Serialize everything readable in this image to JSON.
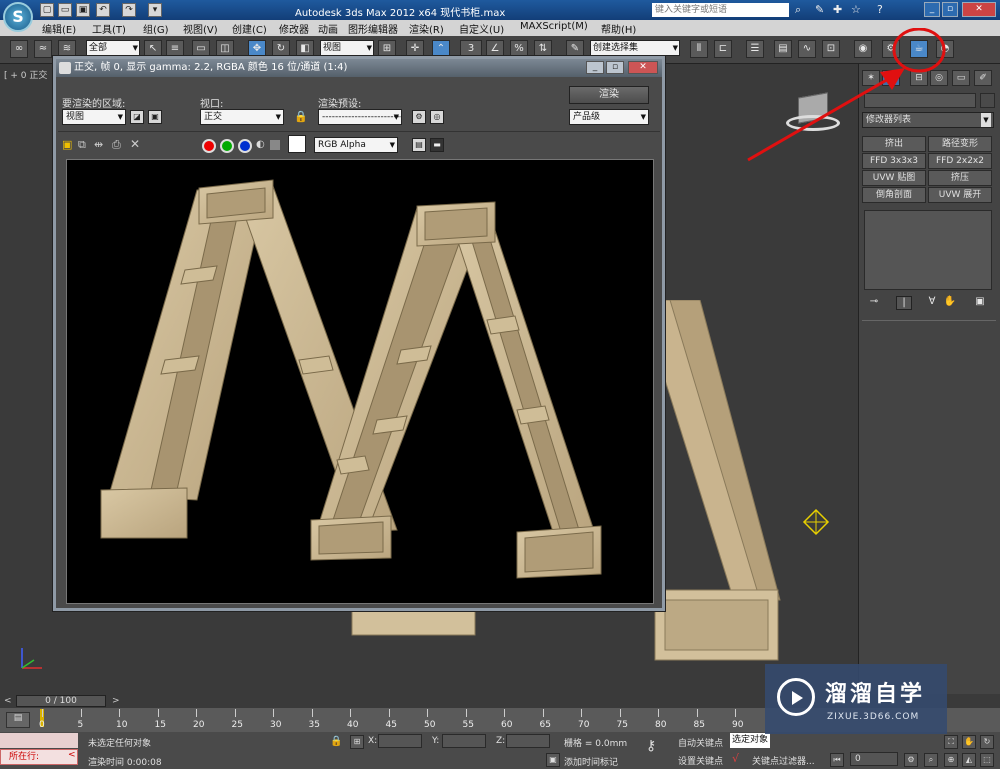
{
  "app": {
    "title": "Autodesk 3ds Max  2012 x64    现代书柜.max",
    "logo": "S",
    "search_placeholder": "键入关键字或短语"
  },
  "menu": [
    "编辑(E)",
    "工具(T)",
    "组(G)",
    "视图(V)",
    "创建(C)",
    "修改器",
    "动画",
    "图形编辑器",
    "渲染(R)",
    "自定义(U)",
    "MAXScript(M)",
    "帮助(H)"
  ],
  "toolbar": {
    "selection_filter": "全部",
    "reference_coord": "视图",
    "named_selection": "创建选择集",
    "snap_value": "3",
    "percent_snap": "%"
  },
  "viewport": {
    "label": "[ + 0 正交"
  },
  "render_window": {
    "title": "正交, 帧 0, 显示 gamma: 2.2, RGBA 颜色 16 位/通道 (1:4)",
    "area_label": "要渲染的区域:",
    "area_value": "视图",
    "viewport_label": "视口:",
    "viewport_value": "正交",
    "preset_label": "渲染预设:",
    "preset_value": "-------------------------",
    "render_button": "渲染",
    "quality_value": "产品级",
    "channel_value": "RGB Alpha"
  },
  "command_panel": {
    "modifier_list": "修改器列表",
    "modifiers": [
      "挤出",
      "路径变形",
      "FFD 3x3x3",
      "FFD 2x2x2",
      "UVW 贴图",
      "挤压",
      "倒角剖面",
      "UVW 展开"
    ]
  },
  "timeline": {
    "frame_display": "0 / 100",
    "ticks": [
      "0",
      "5",
      "10",
      "15",
      "20",
      "25",
      "30",
      "35",
      "40",
      "45",
      "50",
      "55",
      "60",
      "65",
      "70",
      "75",
      "80",
      "85",
      "90"
    ]
  },
  "status": {
    "selection_text": "未选定任何对象",
    "render_time": "渲染时间  0:00:08",
    "running_label": "所在行:",
    "x_label": "X:",
    "y_label": "Y:",
    "z_label": "Z:",
    "grid": "栅格 = 0.0mm",
    "auto_key": "自动关键点",
    "set_key": "设置关键点",
    "selected_value": "选定对象",
    "key_filter": "关键点过滤器...",
    "add_time_tag": "添加时间标记",
    "current_frame": "0"
  },
  "watermark": {
    "brand": "溜溜自学",
    "url": "ZIXUE.3D66.COM"
  },
  "colors": {
    "annotation_red": "#e01010",
    "wood": "#c9b48e"
  }
}
